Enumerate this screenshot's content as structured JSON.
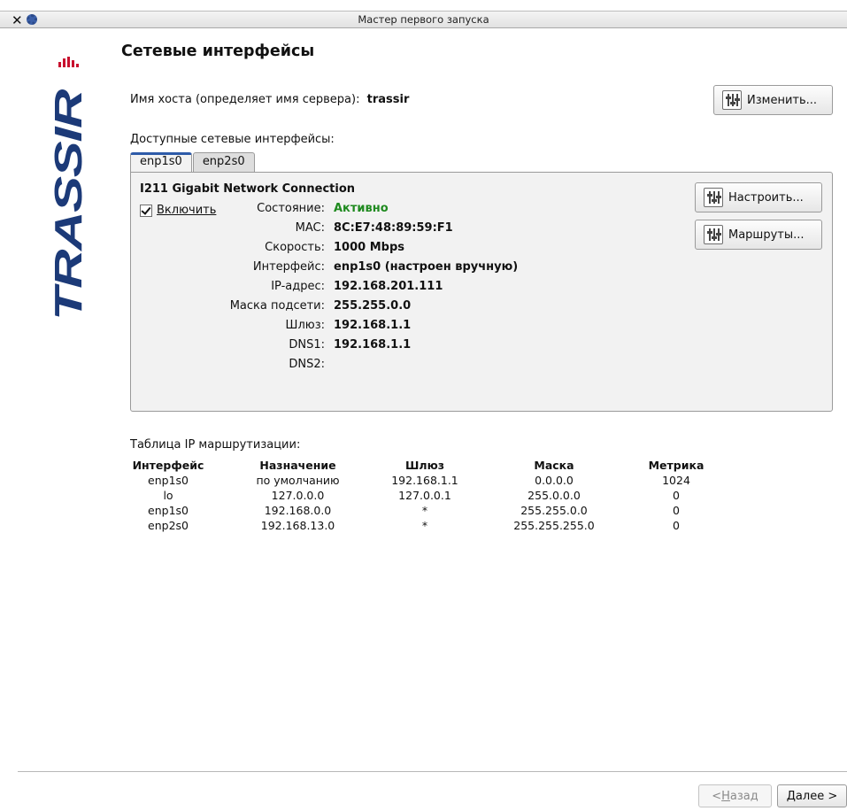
{
  "window": {
    "title": "Мастер первого запуска",
    "close_icon": "✕"
  },
  "logo": {
    "text": "TRASSIR",
    "colors": {
      "primary": "#1c3a78",
      "accent": "#c8102e"
    }
  },
  "page": {
    "title": "Сетевые интерфейсы"
  },
  "hostname": {
    "label": "Имя хоста (определяет имя сервера):",
    "value": "trassir",
    "change_button": "Изменить..."
  },
  "interfaces": {
    "label": "Доступные сетевые интерфейсы:",
    "tabs": [
      "enp1s0",
      "enp2s0"
    ],
    "active_tab": 0,
    "nic_name": "I211 Gigabit Network Connection",
    "enable_label": "Включить",
    "enabled": true,
    "configure_button": "Настроить...",
    "routes_button": "Маршруты...",
    "fields": [
      {
        "label": "Состояние:",
        "value": "Активно"
      },
      {
        "label": "MAC:",
        "value": "8C:E7:48:89:59:F1"
      },
      {
        "label": "Скорость:",
        "value": "1000 Mbps"
      },
      {
        "label": "Интерфейс:",
        "value": "enp1s0 (настроен вручную)"
      },
      {
        "label": "IP-адрес:",
        "value": "192.168.201.111"
      },
      {
        "label": "Маска подсети:",
        "value": "255.255.0.0"
      },
      {
        "label": "Шлюз:",
        "value": "192.168.1.1"
      },
      {
        "label": "DNS1:",
        "value": "192.168.1.1"
      },
      {
        "label": "DNS2:",
        "value": ""
      }
    ],
    "status_color": "#1f8a1f"
  },
  "routing": {
    "label": "Таблица IP маршрутизации:",
    "headers": [
      "Интерфейс",
      "Назначение",
      "Шлюз",
      "Маска",
      "Метрика"
    ],
    "rows": [
      [
        "enp1s0",
        "по умолчанию",
        "192.168.1.1",
        "0.0.0.0",
        "1024"
      ],
      [
        "lo",
        "127.0.0.0",
        "127.0.0.1",
        "255.0.0.0",
        "0"
      ],
      [
        "enp1s0",
        "192.168.0.0",
        "*",
        "255.255.0.0",
        "0"
      ],
      [
        "enp2s0",
        "192.168.13.0",
        "*",
        "255.255.255.0",
        "0"
      ]
    ]
  },
  "nav": {
    "back_prefix": "< ",
    "back_mnemonic": "Н",
    "back_rest": "азад",
    "next_mnemonic": "Д",
    "next_rest": "алее >"
  }
}
